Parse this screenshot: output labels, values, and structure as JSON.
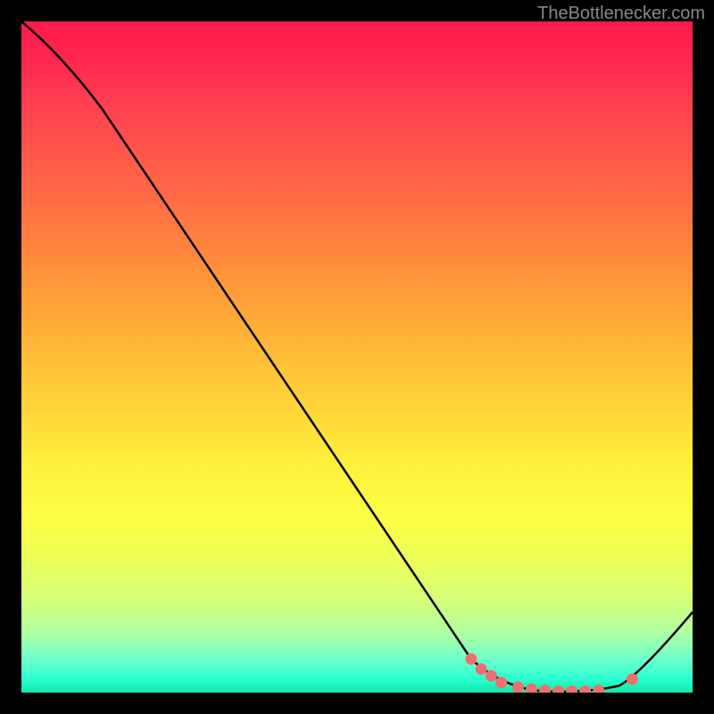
{
  "attribution": "TheBottlenecker.com",
  "chart_data": {
    "type": "line",
    "title": "",
    "xlabel": "",
    "ylabel": "",
    "xlim": [
      0,
      100
    ],
    "ylim": [
      0,
      100
    ],
    "series": [
      {
        "name": "curve",
        "points": [
          {
            "x": 0,
            "y": 100
          },
          {
            "x": 8,
            "y": 92
          },
          {
            "x": 12,
            "y": 87
          },
          {
            "x": 67,
            "y": 5
          },
          {
            "x": 72,
            "y": 1
          },
          {
            "x": 78,
            "y": 0
          },
          {
            "x": 86,
            "y": 0
          },
          {
            "x": 91,
            "y": 2
          },
          {
            "x": 100,
            "y": 12
          }
        ]
      }
    ],
    "markers": [
      {
        "x": 67,
        "y": 5
      },
      {
        "x": 68.5,
        "y": 3.5
      },
      {
        "x": 70,
        "y": 2.5
      },
      {
        "x": 71.5,
        "y": 1.5
      },
      {
        "x": 74,
        "y": 0.8
      },
      {
        "x": 76,
        "y": 0.5
      },
      {
        "x": 78,
        "y": 0.3
      },
      {
        "x": 80,
        "y": 0.2
      },
      {
        "x": 82,
        "y": 0.2
      },
      {
        "x": 84,
        "y": 0.2
      },
      {
        "x": 86,
        "y": 0.3
      },
      {
        "x": 91,
        "y": 2
      }
    ],
    "marker_color": "#ef6f6f",
    "gradient_stops": [
      {
        "offset": 0,
        "color": "#ff1a4a"
      },
      {
        "offset": 50,
        "color": "#ffd038"
      },
      {
        "offset": 100,
        "color": "#10e8a8"
      }
    ]
  }
}
